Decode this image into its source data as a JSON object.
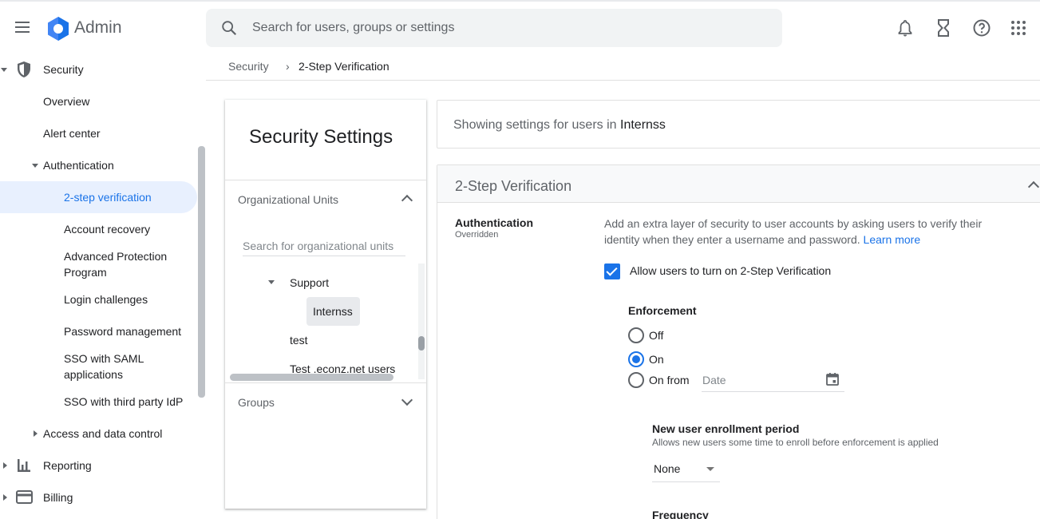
{
  "header": {
    "app_title": "Admin",
    "search_placeholder": "Search for users, groups or settings"
  },
  "sidebar": {
    "security": "Security",
    "overview": "Overview",
    "alert_center": "Alert center",
    "authentication": "Authentication",
    "two_step": "2-step verification",
    "account_recovery": "Account recovery",
    "advanced_protection": [
      "Advanced Protection",
      "Program"
    ],
    "login_challenges": "Login challenges",
    "password_management": "Password management",
    "sso_saml": [
      "SSO with SAML",
      "applications"
    ],
    "sso_third_party": "SSO with third party IdP",
    "access_data_control": "Access and data control",
    "reporting": "Reporting",
    "billing": "Billing"
  },
  "breadcrumb": {
    "parent": "Security",
    "separator": "›",
    "current": "2-Step Verification"
  },
  "settings_panel": {
    "title": "Security Settings",
    "org_units_label": "Organizational Units",
    "org_search_placeholder": "Search for organizational units",
    "units": {
      "support": "Support",
      "internss": "Internss",
      "test": "test",
      "test_econz": "Test .econz.net users"
    },
    "groups_label": "Groups"
  },
  "showing": {
    "prefix": "Showing settings for users in",
    "unit": "Internss"
  },
  "section": {
    "title": "2-Step Verification",
    "auth_label": "Authentication",
    "auth_status": "Overridden",
    "description": "Add an extra layer of security to user accounts by asking users to verify their identity when they enter a username and password.",
    "learn_more": "Learn more",
    "allow_label": "Allow users to turn on 2-Step Verification",
    "allow_checked": true,
    "enforcement_label": "Enforcement",
    "enforcement_options": {
      "off": "Off",
      "on": "On",
      "on_from": "On from"
    },
    "enforcement_selected": "On",
    "date_placeholder": "Date",
    "enrollment_label": "New user enrollment period",
    "enrollment_help": "Allows new users some time to enroll before enforcement is applied",
    "enrollment_value": "None",
    "frequency_label": "Frequency"
  },
  "colors": {
    "accent": "#1a73e8",
    "active_bg": "#e8f0fe",
    "text_secondary": "#5f6368"
  },
  "icons": [
    "menu-icon",
    "admin-logo",
    "search-icon",
    "bell-icon",
    "hourglass-icon",
    "help-icon",
    "apps-grid-icon",
    "shield-icon",
    "bar-chart-icon",
    "credit-card-icon",
    "calendar-icon"
  ]
}
